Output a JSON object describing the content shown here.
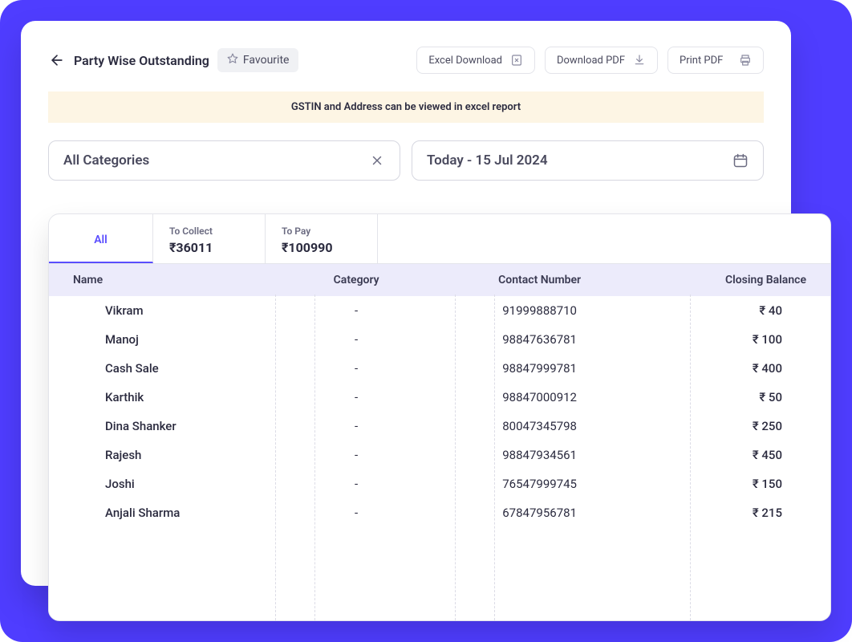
{
  "header": {
    "title": "Party Wise Outstanding",
    "favourite_label": "Favourite",
    "excel_label": "Excel Download",
    "download_pdf_label": "Download PDF",
    "print_pdf_label": "Print PDF"
  },
  "notice": "GSTIN and Address can be viewed in excel report",
  "filters": {
    "category": "All Categories",
    "date": "Today - 15 Jul 2024"
  },
  "tabs": {
    "all_label": "All",
    "to_collect_label": "To Collect",
    "to_collect_value": "₹36011",
    "to_pay_label": "To Pay",
    "to_pay_value": "₹100990"
  },
  "table": {
    "columns": {
      "name": "Name",
      "category": "Category",
      "contact": "Contact Number",
      "balance": "Closing Balance"
    },
    "rows": [
      {
        "name": "Vikram",
        "category": "-",
        "contact": "91999888710",
        "balance": "₹ 40"
      },
      {
        "name": "Manoj",
        "category": "-",
        "contact": "98847636781",
        "balance": "₹ 100"
      },
      {
        "name": "Cash Sale",
        "category": "-",
        "contact": "98847999781",
        "balance": "₹ 400"
      },
      {
        "name": "Karthik",
        "category": "-",
        "contact": "98847000912",
        "balance": "₹ 50"
      },
      {
        "name": "Dina Shanker",
        "category": "-",
        "contact": "80047345798",
        "balance": "₹ 250"
      },
      {
        "name": "Rajesh",
        "category": "-",
        "contact": "98847934561",
        "balance": "₹ 450"
      },
      {
        "name": "Joshi",
        "category": "-",
        "contact": "76547999745",
        "balance": "₹ 150"
      },
      {
        "name": "Anjali Sharma",
        "category": "-",
        "contact": "67847956781",
        "balance": "₹ 215"
      }
    ]
  }
}
